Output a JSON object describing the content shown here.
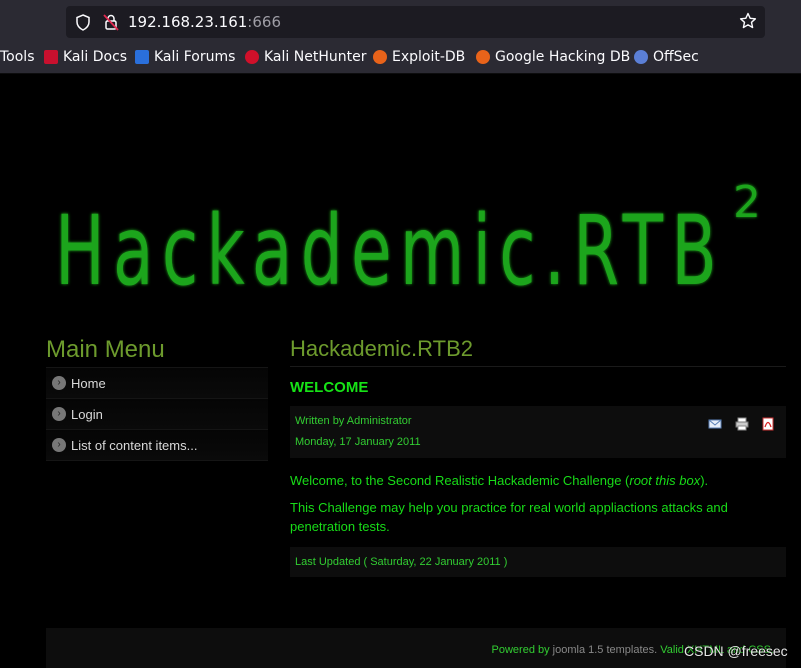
{
  "browser": {
    "url_host": "192.168.23.161",
    "url_port": ":666",
    "bookmarks": [
      {
        "label": "Tools",
        "icon": "tools-icon"
      },
      {
        "label": "Kali Docs",
        "icon": "kali-docs-icon"
      },
      {
        "label": "Kali Forums",
        "icon": "kali-forums-icon"
      },
      {
        "label": "Kali NetHunter",
        "icon": "kali-nethunter-icon"
      },
      {
        "label": "Exploit-DB",
        "icon": "exploit-db-icon"
      },
      {
        "label": "Google Hacking DB",
        "icon": "google-hacking-db-icon"
      },
      {
        "label": "OffSec",
        "icon": "offsec-icon"
      }
    ]
  },
  "site": {
    "logo_text": "Hackademic.RTB",
    "logo_sup": "2",
    "logo_color": "#1fa51b"
  },
  "menu": {
    "title": "Main Menu",
    "items": [
      {
        "label": "Home"
      },
      {
        "label": "Login"
      },
      {
        "label": "List of content items..."
      }
    ]
  },
  "article": {
    "title": "Hackademic.RTB2",
    "heading": "WELCOME",
    "author": "Written by Administrator",
    "date": "Monday, 17 January 2011",
    "p1_before": "Welcome, to the Second Realistic Hackademic Challenge (",
    "p1_em": "root this box",
    "p1_after": ").",
    "p2": "This Challenge may help you practice for real world appliactions attacks and penetration tests.",
    "updated": "Last Updated ( Saturday, 22 January 2011 )",
    "icons": [
      "email-icon",
      "print-icon",
      "pdf-icon"
    ]
  },
  "footer": {
    "powered": "Powered by",
    "rest": " joomla 1.5 templates. ",
    "valid": "Valid XHTML and CSS."
  },
  "watermark": "CSDN @freesec"
}
